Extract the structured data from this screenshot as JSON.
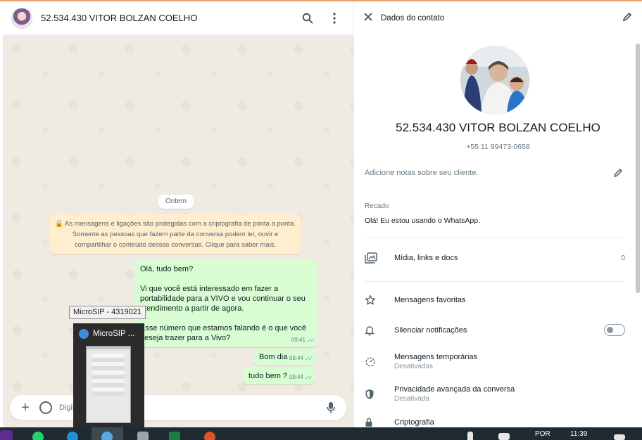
{
  "chat": {
    "header": {
      "contact_name": "52.534.430 VITOR BOLZAN COELHO"
    },
    "date_divider": "Ontem",
    "encryption_notice": "🔒 As mensagens e ligações são protegidas com a criptografia de ponta a ponta. Somente as pessoas que fazem parte da conversa podem ler, ouvir e compartilhar o conteúdo dessas conversas. Clique para saber mais.",
    "messages": [
      {
        "lines": [
          "Olá, tudo bem?",
          "",
          "Vi que você está interessado em fazer a portabilidade para a VIVO e vou continuar o seu atendimento a partir de agora.",
          "",
          "Esse número que estamos falando é o que você deseja trazer para a Vivo?"
        ],
        "time": "09:41"
      },
      {
        "text": "Bom dia",
        "time": "09:44"
      },
      {
        "text": "tudo bem ?",
        "time": "09:44"
      }
    ],
    "composer": {
      "placeholder": "Digite uma mensagem"
    }
  },
  "contact_panel": {
    "title": "Dados do contato",
    "name": "52.534.430 VITOR BOLZAN COELHO",
    "phone": "+55 11 99473-0658",
    "notes_placeholder": "Adicione notas sobre seu cliente.",
    "about_label": "Recado",
    "about_text": "Olá! Eu estou usando o WhatsApp.",
    "media_label": "Mídia, links e docs",
    "media_count": "0",
    "starred_label": "Mensagens favoritas",
    "mute_label": "Silenciar notificações",
    "mute_enabled": false,
    "disappearing_label": "Mensagens temporárias",
    "disappearing_status": "Desativadas",
    "privacy_label": "Privacidade avançada da conversa",
    "privacy_status": "Desativada",
    "encryption_label": "Criptografia"
  },
  "taskbar": {
    "tooltip": "MicroSIP - 4319021",
    "preview_title": "MicroSIP ...",
    "language": "POR",
    "time": "11:39"
  },
  "colors": {
    "chat_background": "#efeae2",
    "outgoing_bubble": "#d9fdd3",
    "notice_background": "#ffeecd",
    "read_ticks": "#53bdeb",
    "taskbar": "#1f2b30"
  }
}
